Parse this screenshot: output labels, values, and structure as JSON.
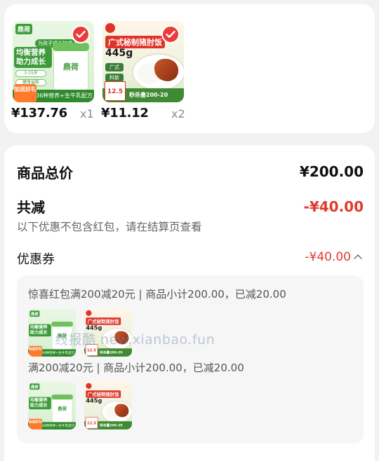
{
  "products": [
    {
      "price": "¥137.76",
      "qty": "x1",
      "image": {
        "brand": "鼎荷",
        "tag": "为孩子成长加减",
        "headline": "均衡营养助力成长",
        "chip1": "3-15岁",
        "chip2": "健身益能",
        "can_brand": "鼎荷",
        "badge": "加送好礼",
        "bottom_text": "36种营养+生牛乳配方"
      }
    },
    {
      "price": "¥11.12",
      "qty": "x2",
      "image": {
        "title": "广式秘制猪肘饭",
        "weight": "445g",
        "pill1": "广式",
        "pill2": "料新",
        "price_tag": "12.5",
        "bottom_text": "秒杀叠200-20"
      }
    }
  ],
  "summary": {
    "total_label": "商品总价",
    "total_value": "¥200.00",
    "discount_label": "共减",
    "discount_value": "-¥40.00",
    "note": "以下优惠不包含红包，请在结算页查看",
    "coupon_label": "优惠券",
    "coupon_value": "-¥40.00"
  },
  "coupon_details": [
    {
      "text": "惊喜红包满200减20元 | 商品小计200.00，已减20.00"
    },
    {
      "text": "满200减20元 | 商品小计200.00，已减20.00"
    }
  ],
  "watermark": "线报酷 new.xianbao.fun",
  "colors": {
    "accent_red": "#e23a2d",
    "check_red": "#ea3c3c",
    "milk_green": "#3e9b3a"
  },
  "icons": {
    "check": "check-circle-icon",
    "collapse": "chevron-up-icon"
  }
}
